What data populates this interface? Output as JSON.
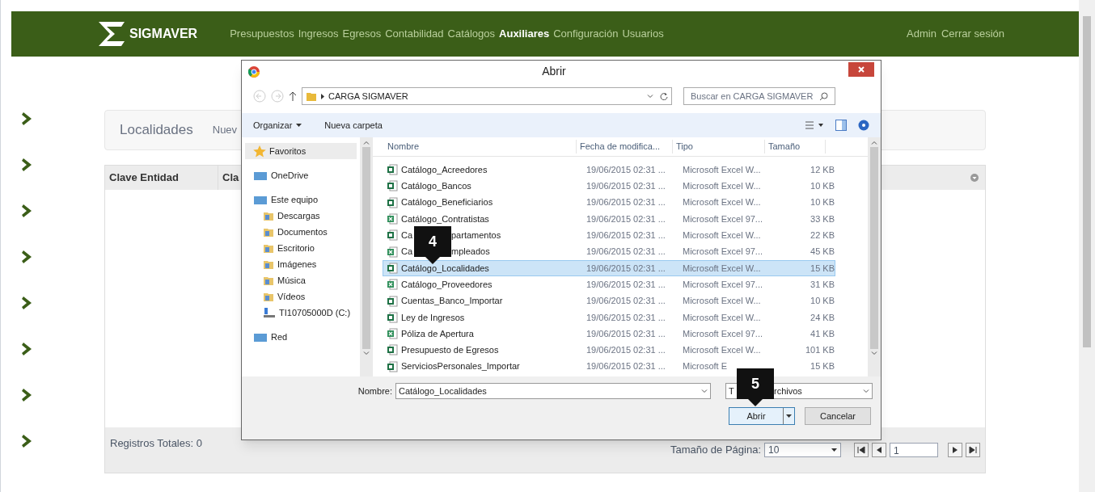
{
  "navbar": {
    "brand": "SIGMAVER",
    "menu": [
      {
        "label": "Presupuestos",
        "selected": false
      },
      {
        "label": "Ingresos",
        "selected": false
      },
      {
        "label": "Egresos",
        "selected": false
      },
      {
        "label": "Contabilidad",
        "selected": false
      },
      {
        "label": "Catálogos",
        "selected": false
      },
      {
        "label": "Auxiliares",
        "selected": true
      },
      {
        "label": "Configuración",
        "selected": false
      },
      {
        "label": "Usuarios",
        "selected": false
      }
    ],
    "user": "Admin",
    "logout": "Cerrar sesión"
  },
  "page": {
    "title": "Localidades",
    "action": "Nuev",
    "columns": [
      "Clave Entidad",
      "Cla"
    ],
    "total": "Registros Totales: 0",
    "page_size_label": "Tamaño de Página:",
    "page_size": "10",
    "page_number": "1"
  },
  "dialog": {
    "title": "Abrir",
    "path": "CARGA SIGMAVER",
    "search_placeholder": "Buscar en CARGA SIGMAVER",
    "organize": "Organizar",
    "new_folder": "Nueva carpeta",
    "nav": [
      {
        "label": "Favoritos",
        "kind": "group",
        "selected": true
      },
      {
        "label": "OneDrive",
        "kind": "group",
        "selected": false
      },
      {
        "label": "Este equipo",
        "kind": "group",
        "selected": false
      },
      {
        "label": "Descargas",
        "kind": "folder",
        "selected": false
      },
      {
        "label": "Documentos",
        "kind": "folder",
        "selected": false
      },
      {
        "label": "Escritorio",
        "kind": "folder",
        "selected": false
      },
      {
        "label": "Imágenes",
        "kind": "folder",
        "selected": false
      },
      {
        "label": "Música",
        "kind": "folder",
        "selected": false
      },
      {
        "label": "Vídeos",
        "kind": "folder",
        "selected": false
      },
      {
        "label": "TI10705000D (C:)",
        "kind": "drive",
        "selected": false
      },
      {
        "label": "Red",
        "kind": "group",
        "selected": false
      }
    ],
    "columns": [
      "Nombre",
      "Fecha de modifica...",
      "Tipo",
      "Tamaño"
    ],
    "files": [
      {
        "name": "Catálogo_Acreedores",
        "date": "19/06/2015 02:31 ...",
        "type": "Microsoft Excel W...",
        "size": "12 KB",
        "kind": "xlsx",
        "selected": false
      },
      {
        "name": "Catálogo_Bancos",
        "date": "19/06/2015 02:31 ...",
        "type": "Microsoft Excel W...",
        "size": "10 KB",
        "kind": "xlsx",
        "selected": false
      },
      {
        "name": "Catálogo_Beneficiarios",
        "date": "19/06/2015 02:31 ...",
        "type": "Microsoft Excel W...",
        "size": "10 KB",
        "kind": "xlsx",
        "selected": false
      },
      {
        "name": "Catálogo_Contratistas",
        "date": "19/06/2015 02:31 ...",
        "type": "Microsoft Excel 97...",
        "size": "33 KB",
        "kind": "xls",
        "selected": false
      },
      {
        "name": "Ca",
        "name_after": "partamentos",
        "date": "19/06/2015 02:31 ...",
        "type": "Microsoft Excel W...",
        "size": "22 KB",
        "kind": "xlsx",
        "selected": false
      },
      {
        "name": "Ca",
        "name_after": "mpleados",
        "date": "19/06/2015 02:31 ...",
        "type": "Microsoft Excel 97...",
        "size": "45 KB",
        "kind": "xls",
        "selected": false
      },
      {
        "name": "Catálogo_Localidades",
        "date": "19/06/2015 02:31 ...",
        "type": "Microsoft Excel W...",
        "size": "15 KB",
        "kind": "xlsx",
        "selected": true
      },
      {
        "name": "Catálogo_Proveedores",
        "date": "19/06/2015 02:31 ...",
        "type": "Microsoft Excel 97...",
        "size": "31 KB",
        "kind": "xls",
        "selected": false
      },
      {
        "name": "Cuentas_Banco_Importar",
        "date": "19/06/2015 02:31 ...",
        "type": "Microsoft Excel W...",
        "size": "10 KB",
        "kind": "xlsx",
        "selected": false
      },
      {
        "name": "Ley de Ingresos",
        "date": "19/06/2015 02:31 ...",
        "type": "Microsoft Excel W...",
        "size": "24 KB",
        "kind": "xlsx",
        "selected": false
      },
      {
        "name": "Póliza de Apertura",
        "date": "19/06/2015 02:31 ...",
        "type": "Microsoft Excel 97...",
        "size": "41 KB",
        "kind": "xls",
        "selected": false
      },
      {
        "name": "Presupuesto de Egresos",
        "date": "19/06/2015 02:31 ...",
        "type": "Microsoft Excel W...",
        "size": "101 KB",
        "kind": "xlsx",
        "selected": false
      },
      {
        "name": "ServiciosPersonales_Importar",
        "date": "19/06/2015 02:31 ...",
        "type": "Microsoft E",
        "size": "15 KB",
        "kind": "xlsx",
        "selected": false
      }
    ],
    "filename_label": "Nombre:",
    "filename": "Catálogo_Localidades",
    "filter": "T",
    "filter_after": "rchivos",
    "open": "Abrir",
    "cancel": "Cancelar"
  },
  "callouts": [
    "4",
    "5"
  ]
}
